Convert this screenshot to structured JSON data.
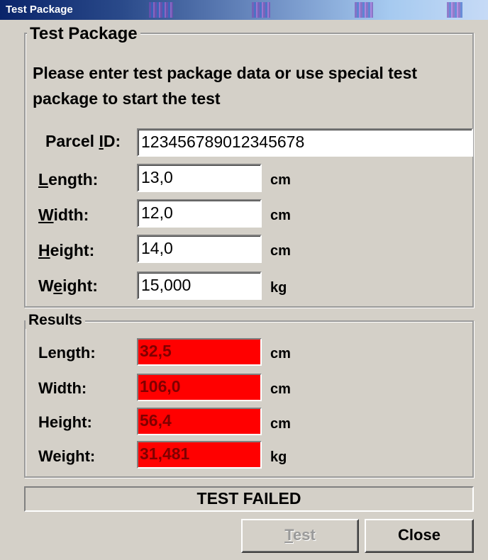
{
  "window": {
    "title": "Test Package"
  },
  "input_group": {
    "legend": "Test Package",
    "instructions_line1": "Please enter test package data or use special test",
    "instructions_line2": "package to start the test",
    "fields": [
      {
        "label_pre": "Parcel ",
        "label_mnemonic": "I",
        "label_post": "D:",
        "value": "123456789012345678",
        "unit": ""
      },
      {
        "label_pre": "",
        "label_mnemonic": "L",
        "label_post": "ength:",
        "value": "13,0",
        "unit": "cm"
      },
      {
        "label_pre": "",
        "label_mnemonic": "W",
        "label_post": "idth:",
        "value": "12,0",
        "unit": "cm"
      },
      {
        "label_pre": "",
        "label_mnemonic": "H",
        "label_post": "eight:",
        "value": "14,0",
        "unit": "cm"
      },
      {
        "label_pre": "W",
        "label_mnemonic": "e",
        "label_post": "ight:",
        "value": "15,000",
        "unit": "kg"
      }
    ]
  },
  "results_group": {
    "legend": "Results",
    "rows": [
      {
        "label": "Length:",
        "value": "32,5",
        "unit": "cm"
      },
      {
        "label": "Width:",
        "value": "106,0",
        "unit": "cm"
      },
      {
        "label": "Height:",
        "value": "56,4",
        "unit": "cm"
      },
      {
        "label": "Weight:",
        "value": "31,481",
        "unit": "kg"
      }
    ],
    "fail_color": "#ff0000"
  },
  "status": {
    "text": "TEST FAILED"
  },
  "buttons": {
    "test_pre": "",
    "test_mnemonic": "T",
    "test_post": "est",
    "close": "Close"
  }
}
